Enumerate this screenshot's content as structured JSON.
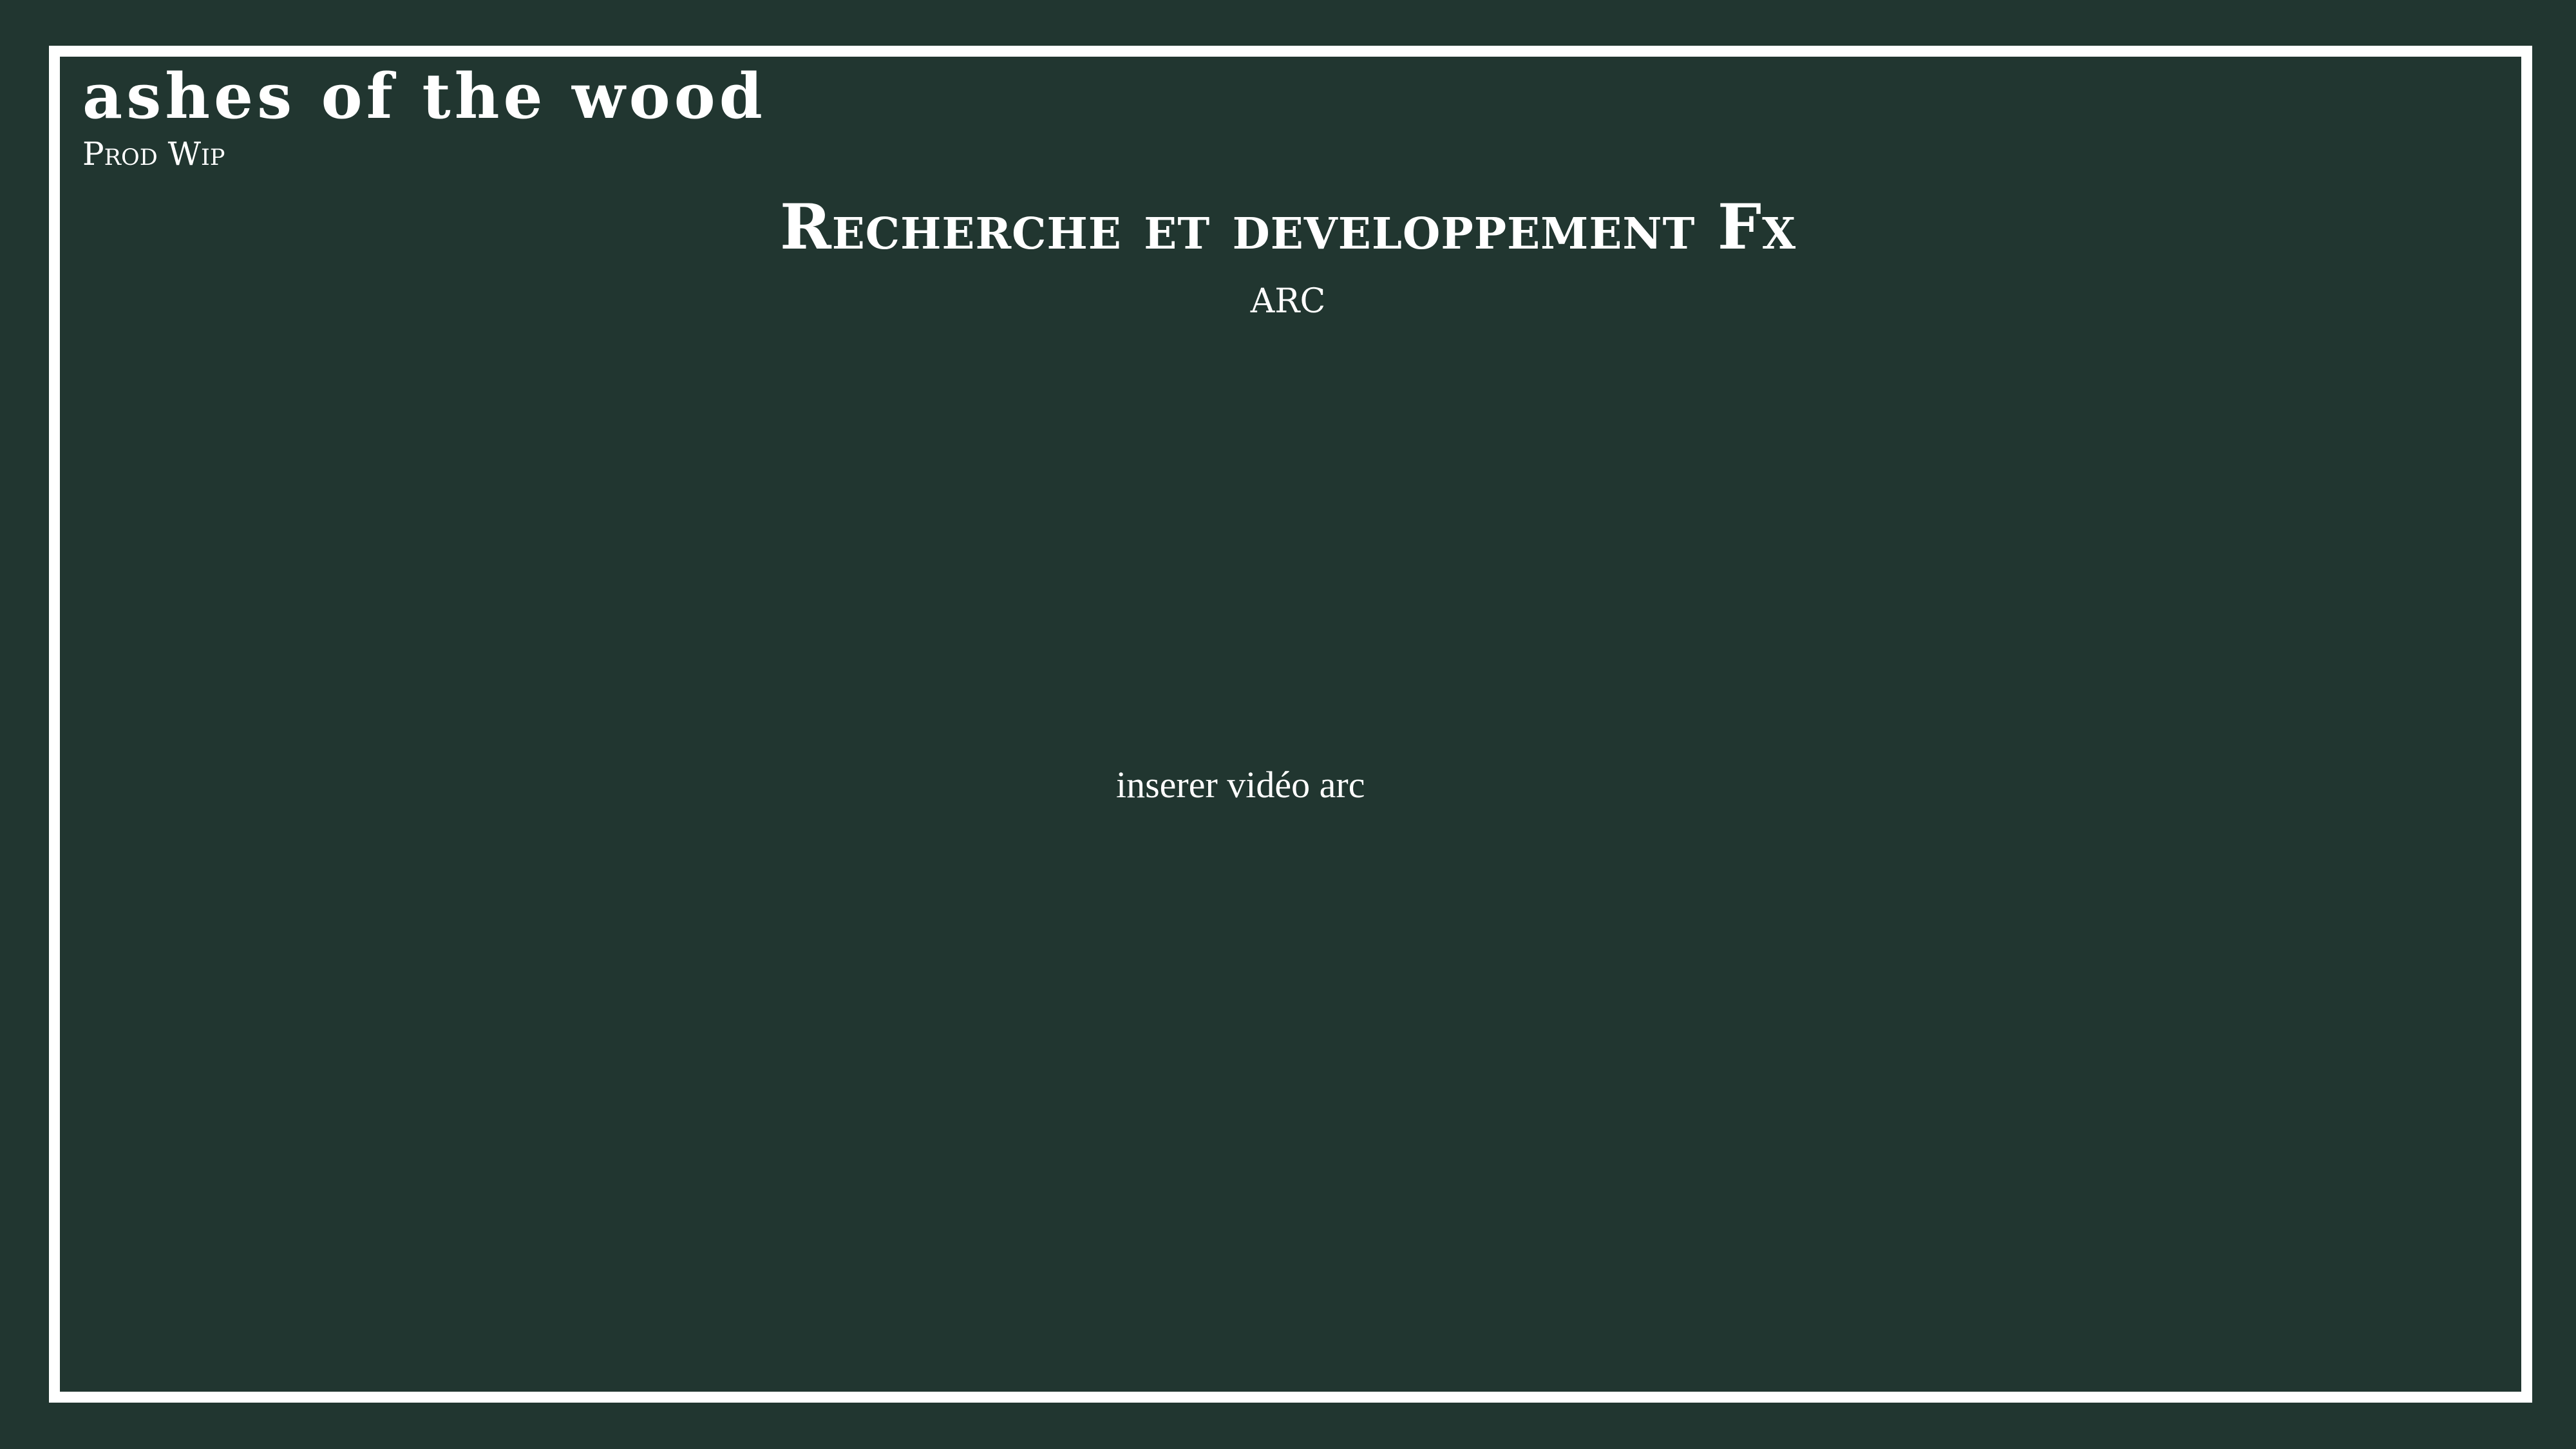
{
  "header": {
    "brand_title": "ashes of the wood",
    "brand_subtitle": "Prod Wip"
  },
  "slide": {
    "title": "Recherche et developpement Fx",
    "subtitle": "ARC",
    "video_placeholder": "inserer vidéo arc"
  },
  "colors": {
    "background": "#213630",
    "frame": "#ffffff",
    "text": "#ffffff"
  }
}
